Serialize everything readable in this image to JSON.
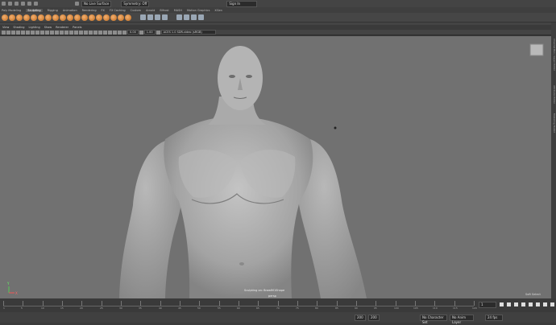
{
  "status": {
    "mode": "No Live Surface",
    "symmetry": "Symmetry: Off",
    "user": "Sign In"
  },
  "shelf_tabs": [
    "Poly Modeling",
    "Sculpting",
    "Rigging",
    "Animation",
    "Rendering",
    "FX",
    "FX Caching",
    "Custom",
    "Arnold",
    "Bifrost",
    "MASH",
    "Motion Graphics",
    "XGen"
  ],
  "panel_menu": [
    "View",
    "Shading",
    "Lighting",
    "Show",
    "Renderer",
    "Panels"
  ],
  "panel_toolbar": {
    "exposure": "0.00",
    "gamma": "1.00",
    "colorspace": "ACES 1.0 SDR-video (sRGB)"
  },
  "viewport": {
    "status_line1": "Sculpting on: BrawlM1Shape",
    "status_line2": "persp",
    "axis_y": "Y",
    "axis_x": "X"
  },
  "right_dock": [
    "Channel Box / Layer Editor",
    "Attribute Editor",
    "Modeling Toolkit"
  ],
  "timeline": {
    "ticks": [
      "1",
      "5",
      "10",
      "15",
      "20",
      "25",
      "30",
      "35",
      "40",
      "45",
      "50",
      "55",
      "60",
      "65",
      "70",
      "75",
      "80",
      "85",
      "90",
      "95",
      "100",
      "105",
      "110",
      "115",
      "120"
    ],
    "current_frame": "1",
    "range_start": "200",
    "range_end": "200",
    "character_set": "No Character Set",
    "anim_layer": "No Anim Layer",
    "fps": "24 fps",
    "soft_select": "Soft Select"
  }
}
